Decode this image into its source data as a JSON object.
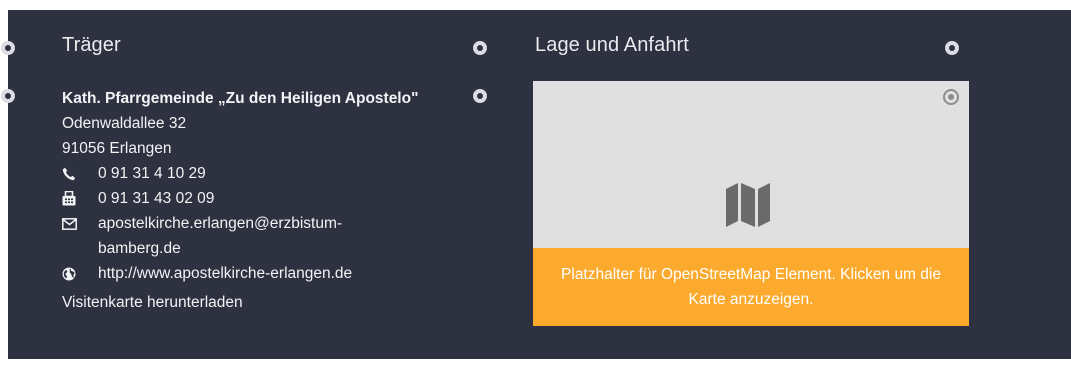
{
  "traeger": {
    "heading": "Träger",
    "name": "Kath. Pfarrgemeinde „Zu den Heiligen Apostelo\"",
    "street": "Odenwaldallee 32",
    "city": "91056 Erlangen",
    "phone": "0 91 31 4 10 29",
    "fax": "0 91 31 43 02 09",
    "email_line1": "apostelkirche.erlangen@erzbistum-",
    "email_line2": "bamberg.de",
    "website": "http://www.apostelkirche-erlangen.de",
    "vcard_link": "Visitenkarte herunterladen"
  },
  "location": {
    "heading": "Lage und Anfahrt",
    "map_notice": "Platzhalter für OpenStreetMap Element. Klicken um die Karte anzuzeigen."
  },
  "icons": {
    "phone": "phone-icon",
    "fax": "fax-icon",
    "email": "envelope-icon",
    "website": "globe-icon",
    "map": "map-icon",
    "edit": "edit-handle-icon"
  },
  "colors": {
    "panel_background": "#2d3140",
    "map_background": "#e0e0e0",
    "map_banner": "#fbaa2e",
    "text": "#f2f3f5"
  }
}
